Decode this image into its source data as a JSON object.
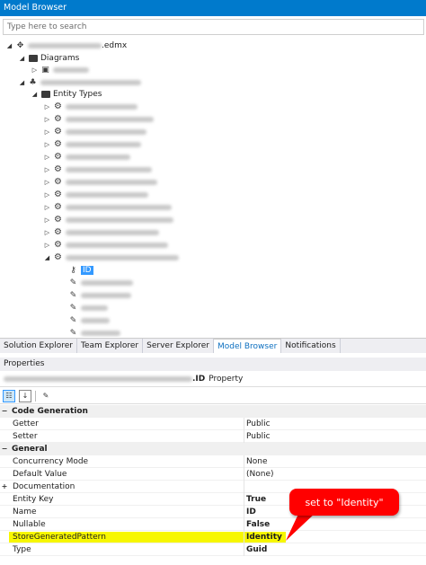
{
  "window": {
    "title": "Model Browser"
  },
  "search": {
    "placeholder": "Type here to search"
  },
  "tree": {
    "root_ext": ".edmx",
    "diagrams_label": "Diagrams",
    "entity_types_label": "Entity Types",
    "selected_property": "ID"
  },
  "tabs": [
    {
      "label": "Solution Explorer"
    },
    {
      "label": "Team Explorer"
    },
    {
      "label": "Server Explorer"
    },
    {
      "label": "Model Browser"
    },
    {
      "label": "Notifications"
    }
  ],
  "properties": {
    "title": "Properties",
    "object_suffix": ".ID",
    "object_kind": "Property",
    "categories": {
      "code_generation": "Code Generation",
      "general": "General"
    },
    "rows": {
      "getter": {
        "name": "Getter",
        "value": "Public"
      },
      "setter": {
        "name": "Setter",
        "value": "Public"
      },
      "concurrency": {
        "name": "Concurrency Mode",
        "value": "None"
      },
      "default_value": {
        "name": "Default Value",
        "value": "(None)"
      },
      "documentation": {
        "name": "Documentation",
        "value": ""
      },
      "entity_key": {
        "name": "Entity Key",
        "value": "True"
      },
      "name": {
        "name": "Name",
        "value": "ID"
      },
      "nullable": {
        "name": "Nullable",
        "value": "False"
      },
      "store_generated": {
        "name": "StoreGeneratedPattern",
        "value": "Identity"
      },
      "type": {
        "name": "Type",
        "value": "Guid"
      }
    }
  },
  "annotation": {
    "text": "set to \"Identity\"",
    "color": "#ff0000"
  },
  "colors": {
    "accent": "#007acc",
    "selection": "#3399ff",
    "highlight": "#f7f700"
  }
}
